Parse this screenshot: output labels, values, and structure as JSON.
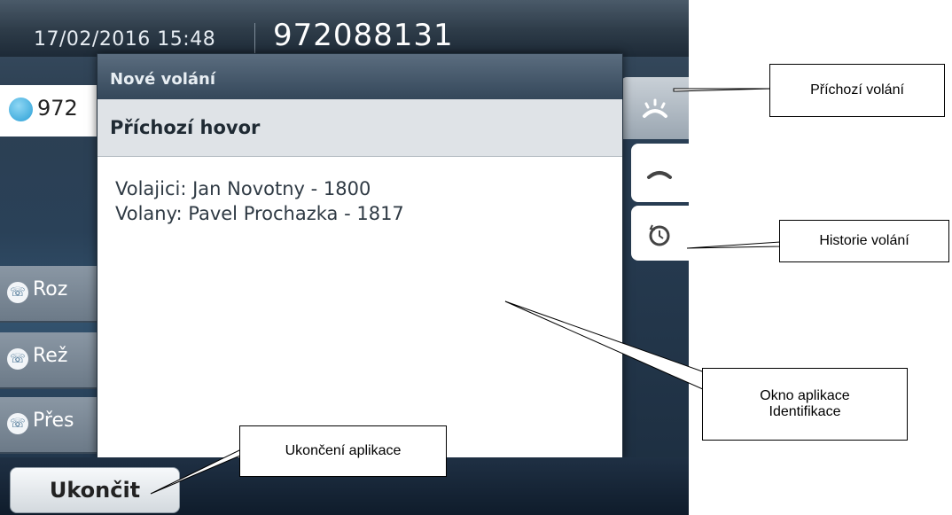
{
  "status_bar": {
    "datetime": "17/02/2016 15:48",
    "number": "972088131"
  },
  "line": {
    "number": "972"
  },
  "side_buttons": [
    {
      "label": "Roz",
      "icon": "softkey-call-icon"
    },
    {
      "label": "Rež",
      "icon": "softkey-call-icon"
    },
    {
      "label": "Přes",
      "icon": "softkey-call-icon"
    }
  ],
  "popup": {
    "title": "Nové volání",
    "heading": "Příchozí hovor",
    "lines": [
      "Volajici: Jan Novotny - 1800",
      "Volany: Pavel Prochazka - 1817"
    ]
  },
  "right_tabs": [
    {
      "name": "incoming-call-icon"
    },
    {
      "name": "handset-icon"
    },
    {
      "name": "history-icon"
    }
  ],
  "exit_button": {
    "label": "Ukončit"
  },
  "callouts": {
    "incoming": "Příchozí volání",
    "history": "Historie volání",
    "window_line1": "Okno aplikace",
    "window_line2": "Identifikace",
    "exit": "Ukončení aplikace"
  },
  "colors": {
    "accent": "#2a9fd6",
    "screen_bg": "#2a4158",
    "titlebar": "#34475a"
  }
}
